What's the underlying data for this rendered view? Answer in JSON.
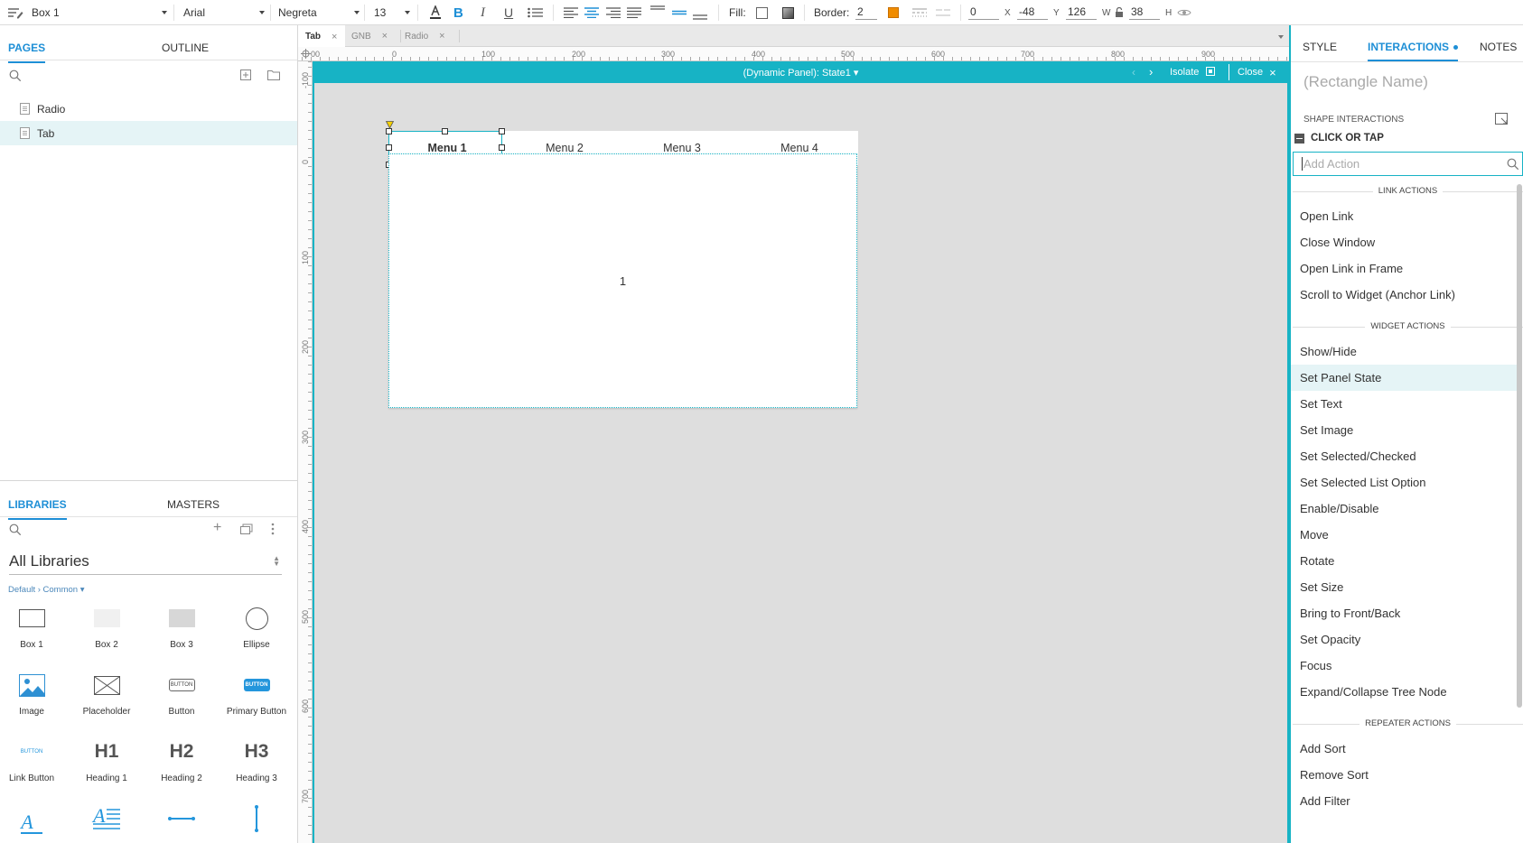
{
  "toolbar": {
    "widget_name": "Box 1",
    "font_family": "Arial",
    "font_weight": "Negreta",
    "font_size": "13",
    "fill_label": "Fill:",
    "border_label": "Border:",
    "border_value": "2",
    "x_value": "0",
    "x_label": "X",
    "y_value": "-48",
    "y_label": "Y",
    "w_value": "126",
    "w_label": "W",
    "h_value": "38",
    "h_label": "H",
    "colors": {
      "font": "#333333",
      "border": "#f08c00",
      "accent": "#1e8fd6"
    }
  },
  "left_panel": {
    "tabs": {
      "pages": "PAGES",
      "outline": "OUTLINE"
    },
    "pages": [
      {
        "label": "Radio"
      },
      {
        "label": "Tab",
        "selected": true
      }
    ],
    "library_tabs": {
      "libraries": "LIBRARIES",
      "masters": "MASTERS"
    },
    "library_title": "All Libraries",
    "library_subtitle": "Default › Common ▾",
    "widgets": [
      {
        "label": "Box 1",
        "icon": "box1-icon"
      },
      {
        "label": "Box 2",
        "icon": "box2-icon"
      },
      {
        "label": "Box 3",
        "icon": "box3-icon"
      },
      {
        "label": "Ellipse",
        "icon": "ellipse-icon"
      },
      {
        "label": "Image",
        "icon": "image-icon"
      },
      {
        "label": "Placeholder",
        "icon": "placeholder-icon"
      },
      {
        "label": "Button",
        "icon": "button-icon",
        "glyph": "BUTTON"
      },
      {
        "label": "Primary Button",
        "icon": "primary-button-icon",
        "glyph": "BUTTON"
      },
      {
        "label": "Link Button",
        "icon": "link-button-icon",
        "glyph": "BUTTON"
      },
      {
        "label": "Heading 1",
        "icon": "heading1-icon",
        "glyph": "H1"
      },
      {
        "label": "Heading 2",
        "icon": "heading2-icon",
        "glyph": "H2"
      },
      {
        "label": "Heading 3",
        "icon": "heading3-icon",
        "glyph": "H3"
      },
      {
        "icon": "text-label-icon",
        "glyph": "A"
      },
      {
        "icon": "paragraph-icon",
        "glyph": "A"
      },
      {
        "icon": "horizontal-line-icon"
      },
      {
        "icon": "vertical-line-icon"
      }
    ]
  },
  "doc_tabs": [
    {
      "label": "Tab",
      "active": true
    },
    {
      "label": "GNB"
    },
    {
      "label": "Radio"
    }
  ],
  "ruler": {
    "h_labels": [
      "00",
      "0",
      "100",
      "200",
      "300",
      "400",
      "500",
      "600",
      "700",
      "800",
      "900"
    ],
    "v_labels": [
      "-100",
      "0",
      "100",
      "200",
      "300",
      "400",
      "500",
      "600",
      "700"
    ]
  },
  "canvas": {
    "panel_title": "(Dynamic Panel): State1 ▾",
    "isolate_label": "Isolate",
    "close_label": "Close",
    "menus": [
      "Menu 1",
      "Menu 2",
      "Menu 3",
      "Menu 4"
    ],
    "content_text": "1"
  },
  "right_panel": {
    "tabs": {
      "style": "STYLE",
      "interactions": "INTERACTIONS",
      "notes": "NOTES"
    },
    "rect_name_placeholder": "(Rectangle Name)",
    "section_label": "SHAPE INTERACTIONS",
    "event_label": "CLICK OR TAP",
    "add_action_placeholder": "Add Action",
    "groups": [
      {
        "title": "LINK ACTIONS",
        "items": [
          "Open Link",
          "Close Window",
          "Open Link in Frame",
          "Scroll to Widget (Anchor Link)"
        ]
      },
      {
        "title": "WIDGET ACTIONS",
        "items": [
          "Show/Hide",
          "Set Panel State",
          "Set Text",
          "Set Image",
          "Set Selected/Checked",
          "Set Selected List Option",
          "Enable/Disable",
          "Move",
          "Rotate",
          "Set Size",
          "Bring to Front/Back",
          "Set Opacity",
          "Focus",
          "Expand/Collapse Tree Node"
        ]
      },
      {
        "title": "REPEATER ACTIONS",
        "items": [
          "Add Sort",
          "Remove Sort",
          "Add Filter"
        ]
      }
    ],
    "highlighted_action": "Set Panel State"
  }
}
